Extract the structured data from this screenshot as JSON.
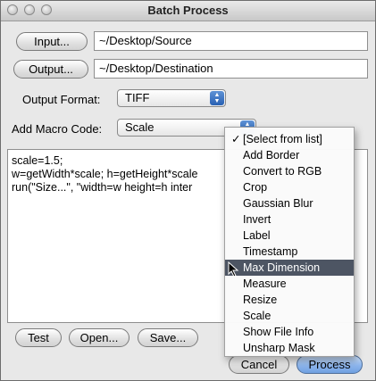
{
  "window": {
    "title": "Batch Process"
  },
  "io": {
    "input_button": "Input...",
    "input_path": "~/Desktop/Source",
    "output_button": "Output...",
    "output_path": "~/Desktop/Destination"
  },
  "format": {
    "label": "Output Format:",
    "value": "TIFF"
  },
  "macro": {
    "label": "Add Macro Code:",
    "value": "Scale"
  },
  "code": {
    "lines": [
      "scale=1.5;",
      "w=getWidth*scale; h=getHeight*scale",
      "run(\"Size...\", \"width=w height=h inter"
    ]
  },
  "buttons": {
    "test": "Test",
    "open": "Open...",
    "save": "Save...",
    "cancel": "Cancel",
    "process": "Process"
  },
  "menu": {
    "checkmark": "✓",
    "items": [
      "[Select from list]",
      "Add Border",
      "Convert to RGB",
      "Crop",
      "Gaussian Blur",
      "Invert",
      "Label",
      "Timestamp",
      "Max Dimension",
      "Measure",
      "Resize",
      "Scale",
      "Show File Info",
      "Unsharp Mask"
    ],
    "checked_item": "[Select from list]",
    "highlighted_item": "Max Dimension"
  },
  "colors": {
    "menu_highlight": "#4d5563",
    "default_button": "#8fb7ee",
    "popup_arrows": "#3a72c4"
  }
}
